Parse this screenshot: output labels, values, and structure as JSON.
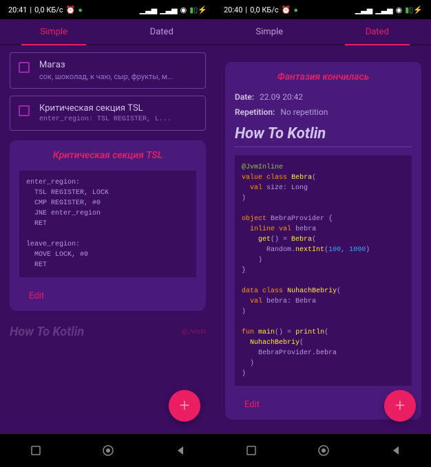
{
  "left": {
    "status": {
      "time": "20:41",
      "speed": "0,0 КБ/с",
      "icons_right": "📶 📶 📡 🔋"
    },
    "tabs": {
      "simple": "Simple",
      "dated": "Dated",
      "active": "simple"
    },
    "notes": [
      {
        "title": "Магаз",
        "subtitle": "сок, шоколад, к чаю, сыр, фрукты, м..."
      },
      {
        "title": "Критическая секция TSL",
        "subtitle": "enter_region:   TSL REGISTER, L..."
      }
    ],
    "card": {
      "title": "Критическая секция TSL",
      "code": "enter_region:\n  TSL REGISTER, LOCK\n  CMP REGISTER, #0\n  JNE enter_region\n  RET\n\nleave_region:\n  MOVE LOCK, #0\n  RET",
      "edit": "Edit"
    },
    "ghost": {
      "text": "How To Kotlin",
      "badge": "@JvmIn"
    },
    "fab": "+"
  },
  "right": {
    "status": {
      "time": "20:40",
      "speed": "0,0 КБ/с",
      "icons_right": "📶 📶 📡 🔋"
    },
    "tabs": {
      "simple": "Simple",
      "dated": "Dated",
      "active": "dated"
    },
    "card": {
      "title": "Фантазия кончилась",
      "date_label": "Date:",
      "date_value": "22.09 20:42",
      "rep_label": "Repetition:",
      "rep_value": "No repetition",
      "heading": "How To Kotlin",
      "edit": "Edit"
    },
    "code_tokens": {
      "l1": "@JvmInline",
      "l2a": "value",
      "l2b": "class",
      "l2c": "Bebra",
      "l2d": "(",
      "l3a": "val",
      "l3b": "size: Long",
      "l4": ")",
      "l5a": "object",
      "l5b": "BebraProvider {",
      "l6a": "inline",
      "l6b": "val",
      "l6c": "bebra",
      "l7a": "get",
      "l7b": "() = ",
      "l7c": "Bebra",
      "l7d": "(",
      "l8a": "Random.",
      "l8b": "nextInt",
      "l8c": "(",
      "l8d": "100",
      "l8e": ", ",
      "l8f": "1000",
      "l8g": ")",
      "l9": ")",
      "l10": "}",
      "l11a": "data",
      "l11b": "class",
      "l11c": "NuhachBebriy",
      "l11d": "(",
      "l12a": "val",
      "l12b": "bebra: Bebra",
      "l13": ")",
      "l14a": "fun",
      "l14b": "main",
      "l14c": "() = ",
      "l14d": "println",
      "l14e": "(",
      "l15": "NuhachBebriy",
      "l15b": "(",
      "l16a": "BebraProvider.",
      "l16b": "bebra",
      "l17": ")",
      "l18": ")"
    },
    "fab": "+"
  }
}
